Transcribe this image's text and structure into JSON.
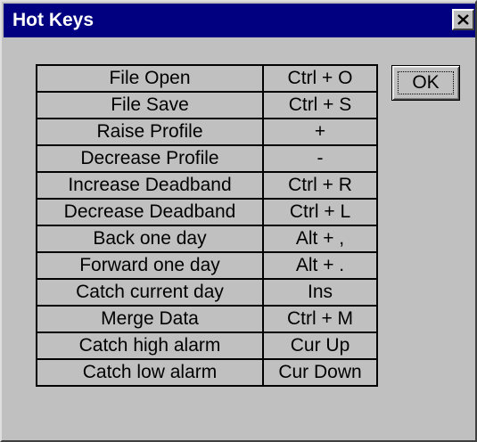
{
  "window": {
    "title": "Hot Keys"
  },
  "titlebar": {
    "background": "#000080",
    "close_icon": "close-x-icon"
  },
  "buttons": {
    "ok_label": "OK"
  },
  "hotkeys": {
    "rows": [
      {
        "action": "File Open",
        "key": "Ctrl + O"
      },
      {
        "action": "File Save",
        "key": "Ctrl + S"
      },
      {
        "action": "Raise Profile",
        "key": "+"
      },
      {
        "action": "Decrease Profile",
        "key": "-"
      },
      {
        "action": "Increase Deadband",
        "key": "Ctrl + R"
      },
      {
        "action": "Decrease Deadband",
        "key": "Ctrl + L"
      },
      {
        "action": "Back one day",
        "key": "Alt + ,"
      },
      {
        "action": "Forward one day",
        "key": "Alt + ."
      },
      {
        "action": "Catch current day",
        "key": "Ins"
      },
      {
        "action": "Merge Data",
        "key": "Ctrl + M"
      },
      {
        "action": "Catch high alarm",
        "key": "Cur Up"
      },
      {
        "action": "Catch low alarm",
        "key": "Cur Down"
      }
    ]
  }
}
